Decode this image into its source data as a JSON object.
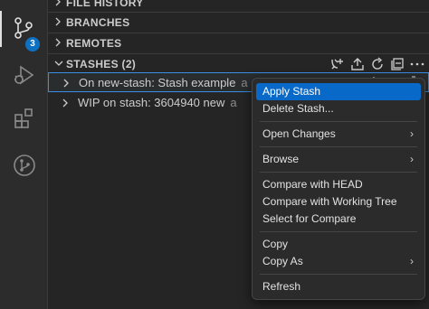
{
  "activity_bar": {
    "badge_count": "3",
    "items": [
      "source-control-icon",
      "run-debug-icon",
      "extensions-icon",
      "git-graph-icon"
    ]
  },
  "sections": {
    "file_history": "FILE HISTORY",
    "branches": "BRANCHES",
    "remotes": "REMOTES",
    "stashes": "STASHES (2)"
  },
  "stashes": [
    {
      "label": "On new-stash: Stash example",
      "desc": "a"
    },
    {
      "label": "WIP on stash: 3604940 new",
      "desc": "a"
    }
  ],
  "context_menu": {
    "apply_stash": "Apply Stash",
    "delete_stash": "Delete Stash...",
    "open_changes": "Open Changes",
    "browse": "Browse",
    "compare_head": "Compare with HEAD",
    "compare_working_tree": "Compare with Working Tree",
    "select_compare": "Select for Compare",
    "copy": "Copy",
    "copy_as": "Copy As",
    "refresh": "Refresh"
  },
  "colors": {
    "accent": "#0869c9",
    "badge": "#0e70c0",
    "selection_border": "#3a8ee6"
  }
}
